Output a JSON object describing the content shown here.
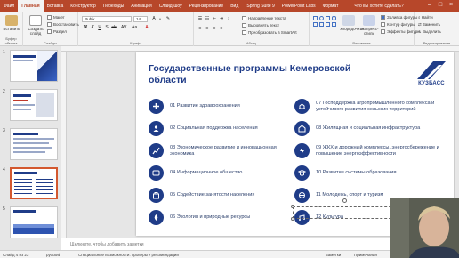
{
  "ribbon_tabs": [
    "Файл",
    "Главная",
    "Вставка",
    "Конструктор",
    "Переходы",
    "Анимация",
    "Слайд-шоу",
    "Рецензирование",
    "Вид",
    "iSpring Suite 9",
    "PowerPoint Labs",
    "Формат"
  ],
  "active_tab": "Главная",
  "tell_me": "Что вы хотите сделать?",
  "ribbon": {
    "paste_label": "Вставить",
    "create_slide_label": "Создать слайд",
    "layout_label": "Макет",
    "reset_label": "Восстановить",
    "section_label": "Раздел",
    "font_name": "Rubik",
    "font_size": "14",
    "text_direction": "Направление текста",
    "align_text": "Выровнять текст",
    "smartart": "Преобразовать в SmartArt",
    "arrange_label": "Упорядочить",
    "quick_styles_label": "Экспресс-стили",
    "shape_fill": "Заливка фигуры",
    "shape_outline": "Контур фигуры",
    "shape_effects": "Эффекты фигуры",
    "find": "Найти",
    "replace": "Заменить",
    "select": "Выделить",
    "groups": {
      "clipboard": "Буфер обмена",
      "slides": "Слайды",
      "font": "Шрифт",
      "paragraph": "Абзац",
      "drawing": "Рисование",
      "editing": "Редактирование"
    }
  },
  "thumbnails": [
    {
      "num": "1"
    },
    {
      "num": "2"
    },
    {
      "num": "3"
    },
    {
      "num": "4"
    },
    {
      "num": "5"
    }
  ],
  "slide": {
    "title": "Государственные программы Кемеровской области",
    "logo_text": "КУЗБАСС",
    "items_left": [
      "01 Развитие здравоохранения",
      "02 Социальная поддержка населения",
      "03 Экономическое развитие и инновационная экономика",
      "04 Информационное общество",
      "05 Содействие занятости населения",
      "06 Экология и природные ресурсы"
    ],
    "items_right": [
      "07 Господдержка агропромышленного комплекса и устойчивого развития сельских территорий",
      "08 Жилищная и социальная инфраструктура",
      "09 ЖКХ и дорожный комплексы, энергосбережение и повышение энергоэффективности",
      "10 Развитие системы образования",
      "11 Молодежь, спорт и туризм",
      "12 Культура"
    ]
  },
  "notes_placeholder": "Щелкните, чтобы добавить заметки",
  "status": {
    "slide_counter": "Слайд 4 из 23",
    "language": "русский",
    "accessibility": "Специальные возможности: проверьте рекомендации",
    "notes_btn": "Заметки",
    "comments_btn": "Примечания"
  }
}
